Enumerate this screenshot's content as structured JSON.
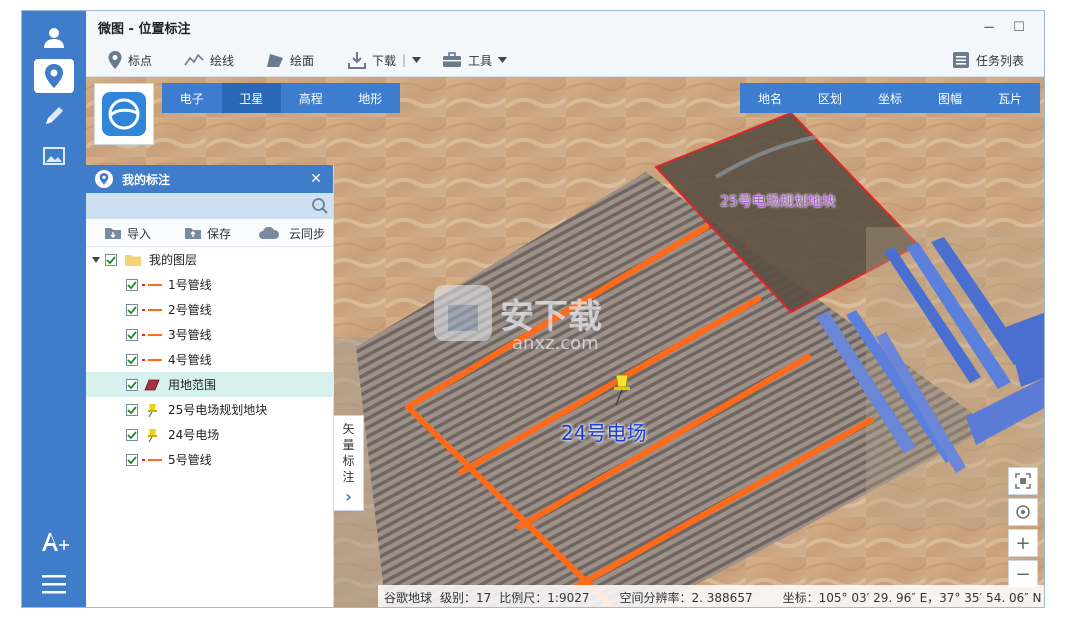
{
  "app": {
    "title": "微图 - 位置标注"
  },
  "window": {
    "minimize": "−",
    "maximize": "☐",
    "close": "✕"
  },
  "rail": {
    "items": [
      "user-icon",
      "location-pin-icon",
      "pencil-icon",
      "image-icon",
      "text-position-icon",
      "menu-icon"
    ],
    "active": "location-pin-icon"
  },
  "toolbar": {
    "mark": "标点",
    "draw_line": "绘线",
    "draw_area": "绘面",
    "download": "下载",
    "download_sep": "|",
    "tools": "工具",
    "task_list": "任务列表"
  },
  "map_types": [
    "电子",
    "卫星",
    "高程",
    "地形"
  ],
  "map_types_active": "卫星",
  "map_options": [
    "地名",
    "区划",
    "坐标",
    "图幅",
    "瓦片"
  ],
  "panel": {
    "title": "我的标注",
    "close": "✕",
    "search_value": "",
    "search_placeholder": "",
    "import": "导入",
    "save": "保存",
    "cloud_sync": "云同步",
    "root_layer": "我的图层",
    "layers": [
      {
        "name": "1号管线",
        "type": "line",
        "checked": true
      },
      {
        "name": "2号管线",
        "type": "line",
        "checked": true
      },
      {
        "name": "3号管线",
        "type": "line",
        "checked": true
      },
      {
        "name": "4号管线",
        "type": "line",
        "checked": true
      },
      {
        "name": "用地范围",
        "type": "polygon",
        "checked": true,
        "selected": true
      },
      {
        "name": "25号电场规划地块",
        "type": "point",
        "checked": true
      },
      {
        "name": "24号电场",
        "type": "point",
        "checked": true
      },
      {
        "name": "5号管线",
        "type": "line",
        "checked": true
      }
    ]
  },
  "side_tab": {
    "label": "矢量标注",
    "arrow": "›"
  },
  "map_labels": {
    "plot_25": "25号电场规划地块",
    "plant_24": "24号电场",
    "watermark": "安下载",
    "watermark_url": "anxz.com"
  },
  "zoom_controls": {
    "fit": "fit-extent-icon",
    "locate": "locate-icon",
    "zoom_in": "+",
    "zoom_out": "−"
  },
  "status_bar": {
    "source": "谷歌地球",
    "level": "级别：17",
    "scale": "比例尺：1:9027",
    "resolution": "空间分辨率：2. 388657",
    "coords": "坐标：105° 03′ 29. 96″ E，37° 35′ 54. 06″ N"
  },
  "colors": {
    "accent": "#3f7cc9",
    "pipeline": "#ff6a1a",
    "boundary": "#e0242a",
    "label_blue": "#1b3fd1",
    "label_purple": "#a95fd6",
    "selected_row": "#d7f2ee"
  }
}
